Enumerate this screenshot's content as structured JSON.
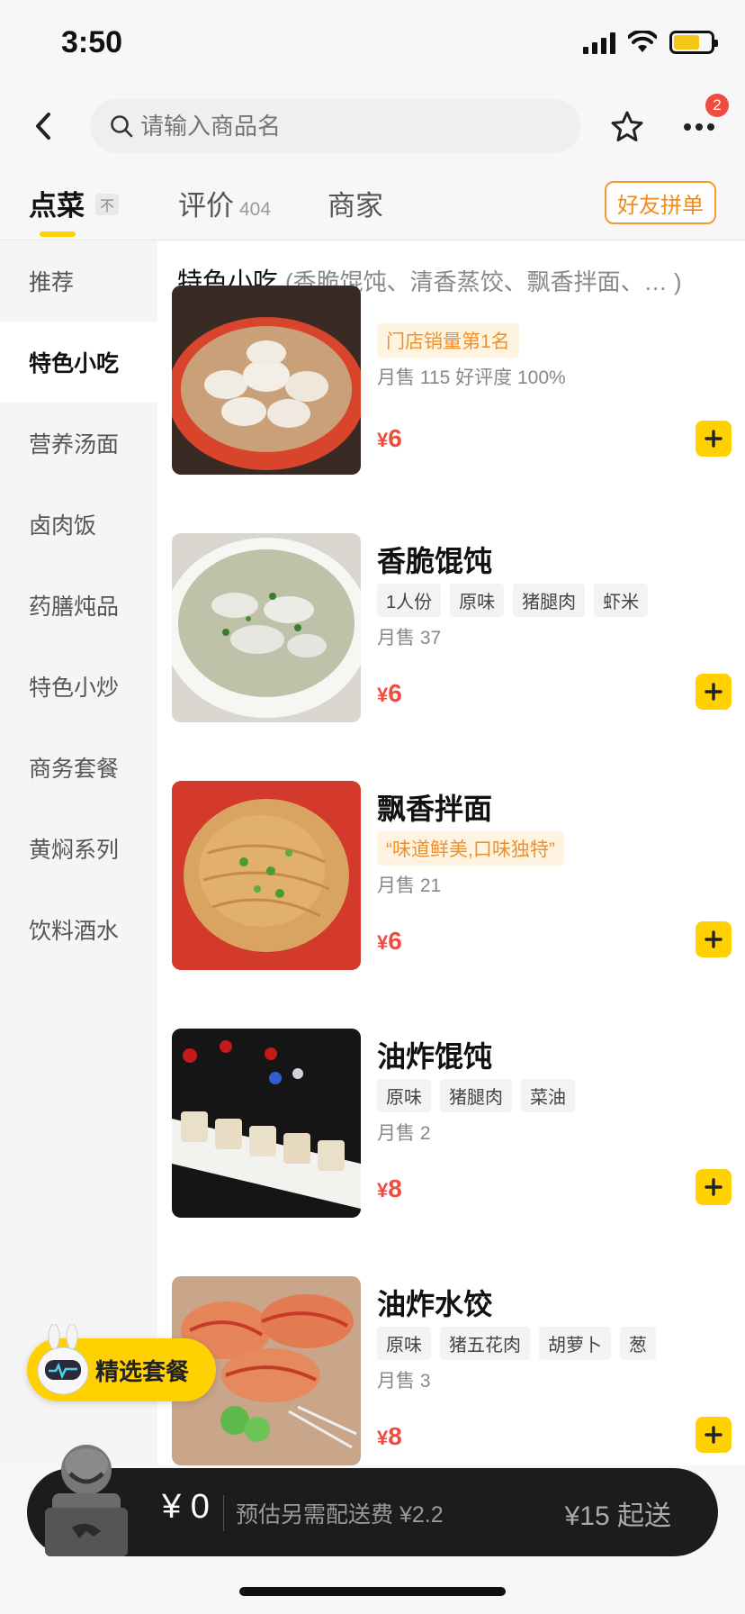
{
  "status_bar": {
    "time": "3:50"
  },
  "nav": {
    "search_placeholder": "请输入商品名",
    "notification_count": "2"
  },
  "tabs": {
    "order": "点菜",
    "order_icon": "不",
    "review": "评价",
    "review_count": "404",
    "merchant": "商家",
    "group_order": "好友拼单"
  },
  "sidebar": {
    "items": [
      {
        "label": "推荐"
      },
      {
        "label": "特色小吃"
      },
      {
        "label": "营养汤面"
      },
      {
        "label": "卤肉饭"
      },
      {
        "label": "药膳炖品"
      },
      {
        "label": "特色小炒"
      },
      {
        "label": "商务套餐"
      },
      {
        "label": "黄焖系列"
      },
      {
        "label": "饮料酒水"
      }
    ],
    "active_index": 1
  },
  "section": {
    "title": "特色小吃",
    "subtitle": "(香脆馄饨、清香蒸饺、飘香拌面、… )"
  },
  "items": [
    {
      "name": "",
      "promo": "门店销量第1名",
      "sales": "月售 115  好评度 100%",
      "price_symbol": "¥",
      "price": "6"
    },
    {
      "name": "香脆馄饨",
      "tags": [
        "1人份",
        "原味",
        "猪腿肉",
        "虾米"
      ],
      "sales": "月售 37",
      "price_symbol": "¥",
      "price": "6"
    },
    {
      "name": "飘香拌面",
      "promo": "“味道鲜美,口味独特”",
      "sales": "月售 21",
      "price_symbol": "¥",
      "price": "6"
    },
    {
      "name": "油炸馄饨",
      "tags": [
        "原味",
        "猪腿肉",
        "菜油"
      ],
      "sales": "月售 2",
      "price_symbol": "¥",
      "price": "8"
    },
    {
      "name": "油炸水饺",
      "tags": [
        "原味",
        "猪五花肉",
        "胡萝卜",
        "葱"
      ],
      "sales": "月售 3",
      "price_symbol": "¥",
      "price": "8"
    }
  ],
  "set_meal": {
    "label": "精选套餐"
  },
  "cart": {
    "amount": "¥ 0",
    "delivery_fee": "预估另需配送费 ¥2.2",
    "min_order": "¥15 起送"
  },
  "colors": {
    "accent_yellow": "#ffd100",
    "price_red": "#ef4b3f",
    "group_orange": "#f28a1a"
  }
}
